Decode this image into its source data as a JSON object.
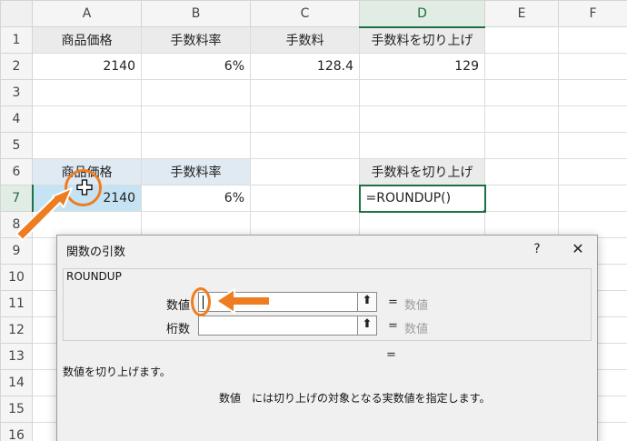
{
  "columns": [
    "A",
    "B",
    "C",
    "D",
    "E",
    "F"
  ],
  "rows": [
    "1",
    "2",
    "3",
    "4",
    "5",
    "6",
    "7",
    "8",
    "9",
    "10",
    "11",
    "12",
    "13",
    "14",
    "15",
    "16"
  ],
  "table1": {
    "headers": [
      "商品価格",
      "手数料率",
      "手数料",
      "手数料を切り上げ"
    ],
    "values": [
      "2140",
      "6%",
      "128.4",
      "129"
    ]
  },
  "table2": {
    "headers": [
      "商品価格",
      "手数料率",
      "手数料を切り上げ"
    ],
    "values": [
      "2140",
      "6%"
    ],
    "formula": "=ROUNDUP()"
  },
  "dialog": {
    "title": "関数の引数",
    "help": "?",
    "close": "✕",
    "function_name": "ROUNDUP",
    "args": [
      {
        "label": "数値",
        "value": "",
        "eq": "=",
        "result": "数値"
      },
      {
        "label": "桁数",
        "value": "",
        "eq": "=",
        "result": "数値"
      }
    ],
    "result_eq": "=",
    "function_description": "数値を切り上げます。",
    "argument_help": "数値　には切り上げの対象となる実数値を指定します。"
  },
  "colors": {
    "accent": "#ee7d22",
    "excel_green": "#1e7145",
    "selection_blue": "#c5e3f3"
  },
  "icons": {
    "cursor": "plus-cursor-icon",
    "ref": "collapse-dialog-icon"
  }
}
